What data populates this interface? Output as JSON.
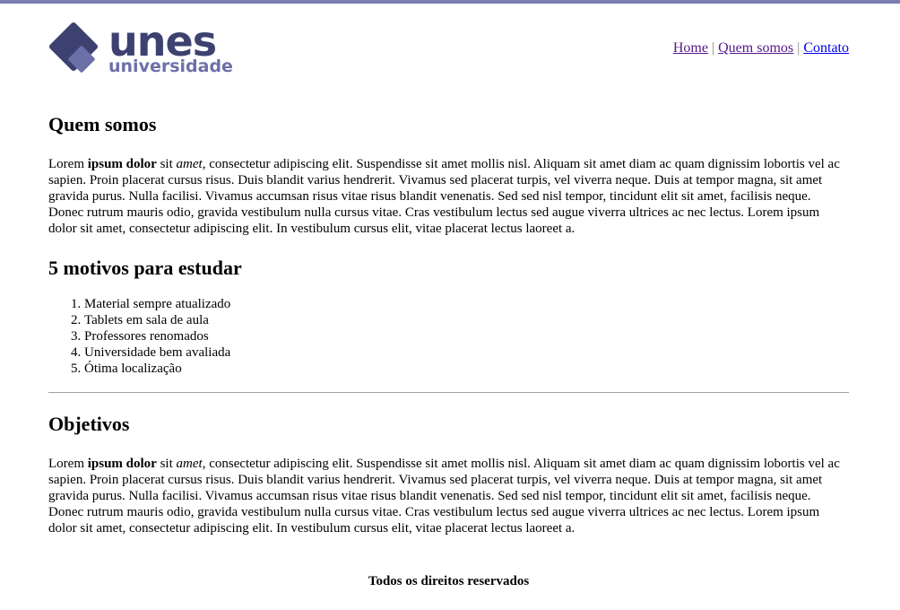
{
  "brand": {
    "logo_main": "unes",
    "logo_sub": "universidade"
  },
  "nav": [
    {
      "label": "Home"
    },
    {
      "label": "Quem somos"
    },
    {
      "label": "Contato"
    }
  ],
  "nav_separator": "|",
  "sections": {
    "quem_somos": {
      "title": "Quem somos",
      "p_start": "Lorem ",
      "p_bold": "ipsum dolor",
      "p_mid": " sit ",
      "p_italic": "amet",
      "p_rest": ", consectetur adipiscing elit. Suspendisse sit amet mollis nisl. Aliquam sit amet diam ac quam dignissim lobortis vel ac sapien. Proin placerat cursus risus. Duis blandit varius hendrerit. Vivamus sed placerat turpis, vel viverra neque. Duis at tempor magna, sit amet gravida purus. Nulla facilisi. Vivamus accumsan risus vitae risus blandit venenatis. Sed sed nisl tempor, tincidunt elit sit amet, facilisis neque. Donec rutrum mauris odio, gravida vestibulum nulla cursus vitae. Cras vestibulum lectus sed augue viverra ultrices ac nec lectus. Lorem ipsum dolor sit amet, consectetur adipiscing elit. In vestibulum cursus elit, vitae placerat lectus laoreet a."
    },
    "motivos": {
      "title": "5 motivos para estudar",
      "items": [
        "Material sempre atualizado",
        "Tablets em sala de aula",
        "Professores renomados",
        "Universidade bem avaliada",
        "Ótima localização"
      ]
    },
    "objetivos": {
      "title": "Objetivos",
      "p_start": "Lorem ",
      "p_bold": "ipsum dolor",
      "p_mid": " sit ",
      "p_italic": "amet",
      "p_rest": ", consectetur adipiscing elit. Suspendisse sit amet mollis nisl. Aliquam sit amet diam ac quam dignissim lobortis vel ac sapien. Proin placerat cursus risus. Duis blandit varius hendrerit. Vivamus sed placerat turpis, vel viverra neque. Duis at tempor magna, sit amet gravida purus. Nulla facilisi. Vivamus accumsan risus vitae risus blandit venenatis. Sed sed nisl tempor, tincidunt elit sit amet, facilisis neque. Donec rutrum mauris odio, gravida vestibulum nulla cursus vitae. Cras vestibulum lectus sed augue viverra ultrices ac nec lectus. Lorem ipsum dolor sit amet, consectetur adipiscing elit. In vestibulum cursus elit, vitae placerat lectus laoreet a."
    }
  },
  "footer": {
    "text": "Todos os direitos reservados"
  },
  "colors": {
    "brand_dark": "#3d4170",
    "brand_light": "#6b70a8",
    "top_border": "#7a7fb0"
  }
}
